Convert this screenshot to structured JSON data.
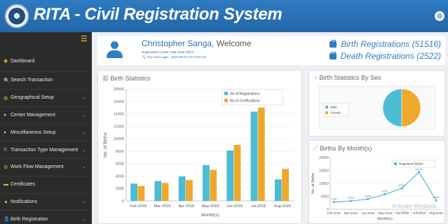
{
  "header": {
    "title": "RITA - Civil Registration System",
    "logo": {
      "text": "RITA",
      "icon": "seal-logo"
    },
    "settings_icon": "gear-icon"
  },
  "sidebar": {
    "toggle_icon": "menu-toggle-icon",
    "items": [
      {
        "label": "Dashboard",
        "icon": "dashboard-icon",
        "chevron": false
      },
      {
        "label": "Search Transaction",
        "icon": "search-icon",
        "chevron": false
      },
      {
        "label": "Geographical Setup",
        "icon": "globe-icon",
        "chevron": true
      },
      {
        "label": "Center Management",
        "icon": "circle-icon",
        "chevron": true
      },
      {
        "label": "Miscellaneous Setup",
        "icon": "circle-icon",
        "chevron": true
      },
      {
        "label": "Transaction Type Management",
        "icon": "transaction-icon",
        "chevron": true
      },
      {
        "label": "Work Flow Management",
        "icon": "workflow-icon",
        "chevron": true
      },
      {
        "label": "Certificates",
        "icon": "certificate-icon",
        "chevron": false
      },
      {
        "label": "Notifications",
        "icon": "warning-icon",
        "chevron": true
      },
      {
        "label": "Birth Registration",
        "icon": "user-icon",
        "chevron": true
      }
    ]
  },
  "welcome": {
    "name": "Christopher Sanga,",
    "greeting": "Welcome",
    "center": "Registration Center :Rita Head Office",
    "last_login": "Your Last Login - 2018-08-07 14:17:04.721",
    "birth_registrations": "Birth Registrations (51516)",
    "death_registrations": "Death Registrations (2522)"
  },
  "panels": {
    "birth_statistics": "Birth Statistics",
    "by_sex": "Birth Statistics By Sex",
    "by_month": "Births By Month(s)"
  },
  "colors": {
    "header": "#2367a8",
    "sidebar": "#2b2b2b",
    "registrations": "#4bbcd4",
    "certifications": "#f0a92c",
    "male": "#4bbcd4",
    "female": "#f0a92c",
    "line": "#4bbcd4"
  },
  "chart_data": [
    {
      "type": "bar",
      "title": "Birth Statistics",
      "xlabel": "Month(s)",
      "ylabel": "No. of Births",
      "categories": [
        "Feb-2018",
        "Mar-2018",
        "Apr-2018",
        "May-2018",
        "Jun-2018",
        "Jul-2018",
        "Aug-2018"
      ],
      "ylim": [
        0,
        18000
      ],
      "yticks": [
        0,
        2000,
        4000,
        6000,
        8000,
        10000,
        12000,
        14000,
        16000,
        18000
      ],
      "legend": "top-right",
      "series": [
        {
          "name": "No.of Registrations",
          "values": [
            2780,
            3200,
            3930,
            5770,
            8100,
            14350,
            3450
          ]
        },
        {
          "name": "No.of Certifications",
          "values": [
            2400,
            2870,
            3350,
            5000,
            9000,
            15000,
            5150
          ]
        }
      ]
    },
    {
      "type": "pie",
      "title": "Birth Statistics By Sex",
      "legend": "left",
      "labels": [
        "Male",
        "Female"
      ],
      "values": [
        50,
        50
      ]
    },
    {
      "type": "line",
      "title": "Births By Month(s)",
      "xlabel": "Month(s)",
      "ylabel": "No. of Births",
      "categories": [
        "Feb-2018",
        "Mar-2018",
        "Apr-2018",
        "May-2018",
        "Jun-2018",
        "Jul-2018",
        "Aug-2018"
      ],
      "ylim": [
        0,
        20000
      ],
      "yticks": [
        0,
        5000,
        10000,
        15000,
        20000
      ],
      "legend": "top-right",
      "series": [
        {
          "name": "Registered Births",
          "values": [
            2780,
            3200,
            3930,
            5770,
            8100,
            14350,
            3450
          ]
        }
      ],
      "data_labels": [
        "2780",
        "3218",
        "3926",
        "5767",
        "8102",
        "14347",
        "3446"
      ]
    }
  ],
  "watermark": {
    "line1": "Activate Windows",
    "line2": "Go to Settings to activate Windows."
  }
}
